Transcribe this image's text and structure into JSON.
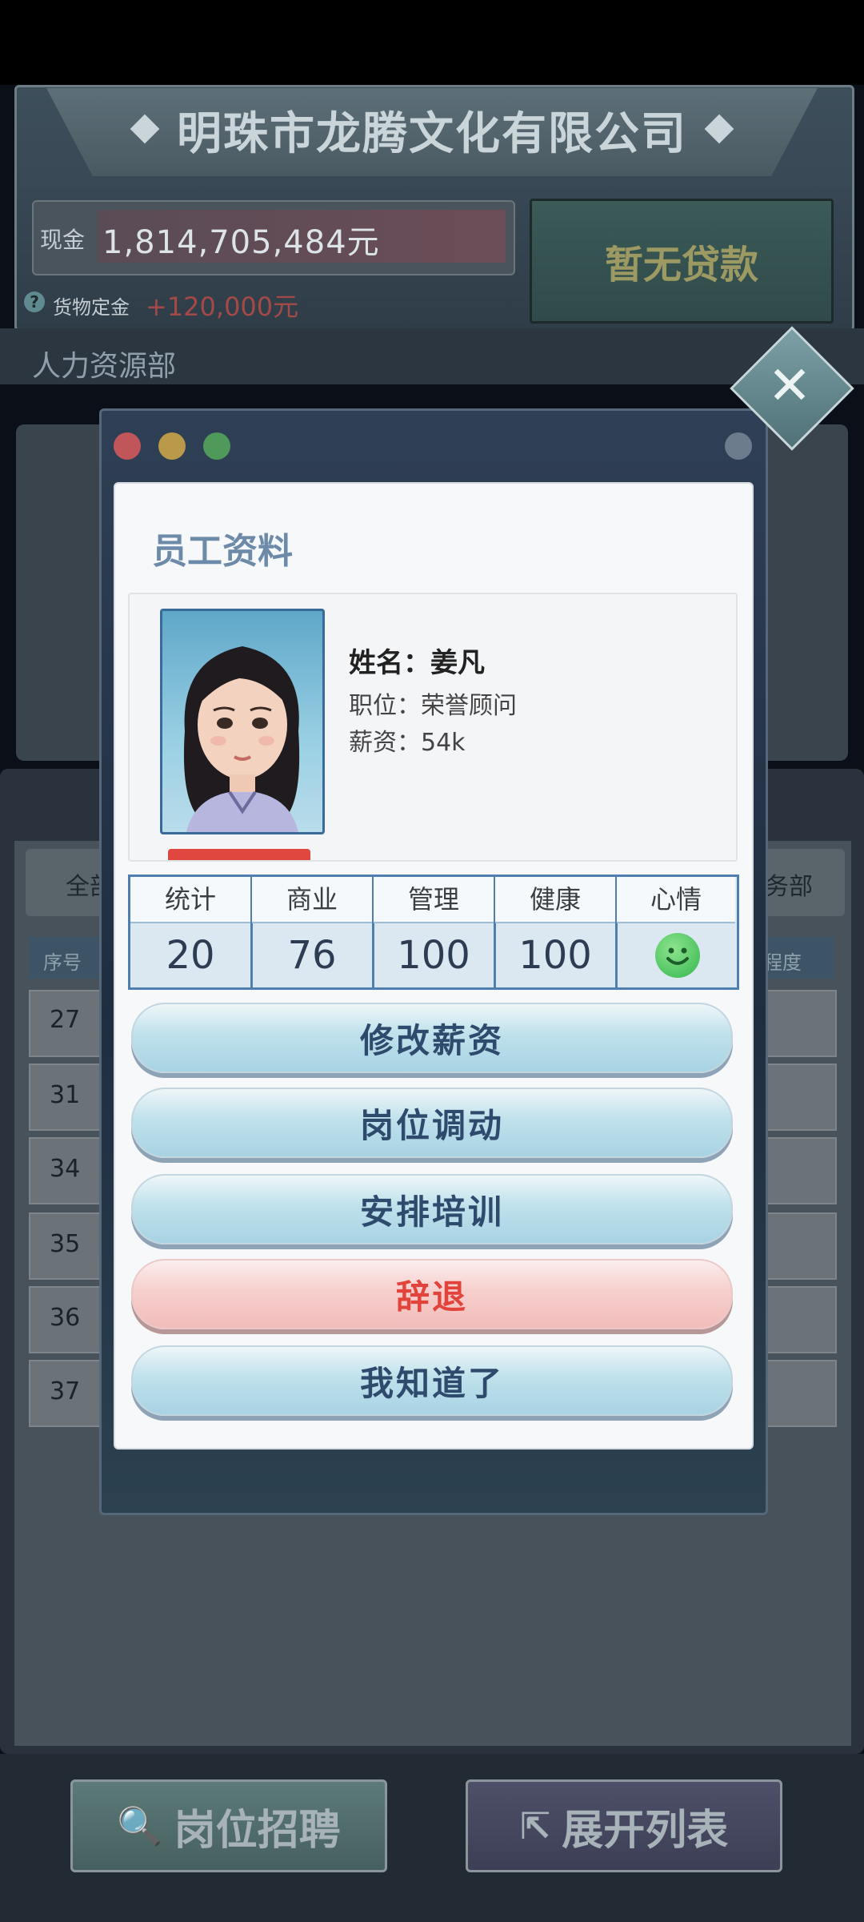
{
  "company": {
    "name": "明珠市龙腾文化有限公司"
  },
  "finance": {
    "cash_label": "现金",
    "cash_value": "1,814,705,484元",
    "loan_button": "暂无贷款",
    "deposit_label": "货物定金",
    "deposit_value": "+120,000元"
  },
  "department": {
    "title": "人力资源部"
  },
  "background_list": {
    "filter_left": "全部",
    "filter_right": "务部",
    "header_left": "序号",
    "header_right": "程度",
    "rows": [
      "27",
      "31",
      "34",
      "35",
      "36",
      "37"
    ]
  },
  "bottom_bar": {
    "recruit_label": "岗位招聘",
    "expand_label": "展开列表"
  },
  "dialog": {
    "title": "员工资料",
    "employee": {
      "name_line": "姓名：姜凡",
      "position_line": "职位：荣誉顾问",
      "salary_line": "薪资：54k"
    },
    "stats": [
      {
        "label": "统计",
        "value": "20"
      },
      {
        "label": "商业",
        "value": "76"
      },
      {
        "label": "管理",
        "value": "100"
      },
      {
        "label": "健康",
        "value": "100"
      },
      {
        "label": "心情",
        "value": ""
      }
    ],
    "mood_icon": "smiley-face-icon",
    "buttons": {
      "change_salary": "修改薪资",
      "transfer": "岗位调动",
      "training": "安排培训",
      "dismiss": "辞退",
      "acknowledge": "我知道了"
    }
  },
  "colors": {
    "accent_blue": "#2e4a6d",
    "dismiss_red": "#e2443b",
    "stat_border": "#4f7fae"
  }
}
